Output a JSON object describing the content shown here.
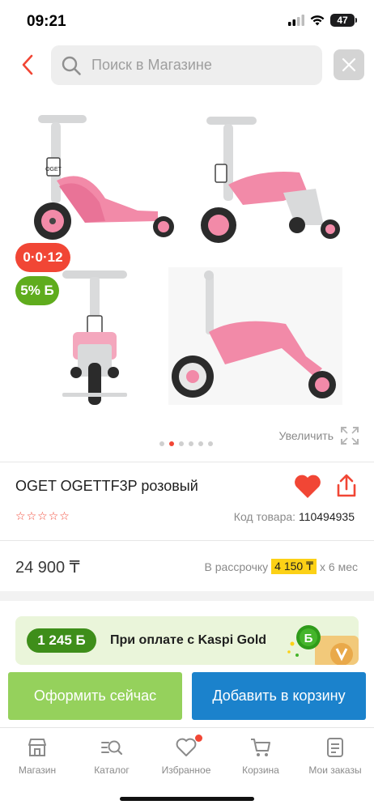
{
  "status_bar": {
    "time": "09:21",
    "battery": "47"
  },
  "search": {
    "placeholder": "Поиск в Магазине"
  },
  "gallery": {
    "badges": {
      "installment": "0·0·12",
      "bonus": "5% Б"
    },
    "zoom_label": "Увеличить",
    "dots_count": 6,
    "active_dot": 1,
    "brand_plate": "OGET"
  },
  "product": {
    "title": "OGET OGETTF3P розовый",
    "rating_stars": 5,
    "code_label": "Код товара:",
    "code_value": "110494935",
    "price": "24 900 ₸",
    "installment_prefix": "В рассрочку",
    "installment_monthly": "4 150 ₸",
    "installment_term": "х 6 мес"
  },
  "kaspi_gold": {
    "amount": "1 245 Б",
    "text": "При оплате с Kaspi Gold"
  },
  "actions": {
    "order": "Оформить сейчас",
    "cart": "Добавить в корзину"
  },
  "tabs": [
    {
      "label": "Магазин",
      "icon": "store-icon"
    },
    {
      "label": "Каталог",
      "icon": "catalog-search-icon"
    },
    {
      "label": "Избранное",
      "icon": "heart-icon"
    },
    {
      "label": "Корзина",
      "icon": "cart-icon"
    },
    {
      "label": "Мои заказы",
      "icon": "orders-icon"
    }
  ],
  "colors": {
    "accent_red": "#f14635",
    "kaspi_green": "#3e8e1a",
    "order_button": "#95d15c",
    "cart_button": "#1b82cc",
    "installment_highlight": "#fcd116",
    "scooter_pink": "#f28aa8",
    "scooter_gray": "#d9dadb"
  }
}
